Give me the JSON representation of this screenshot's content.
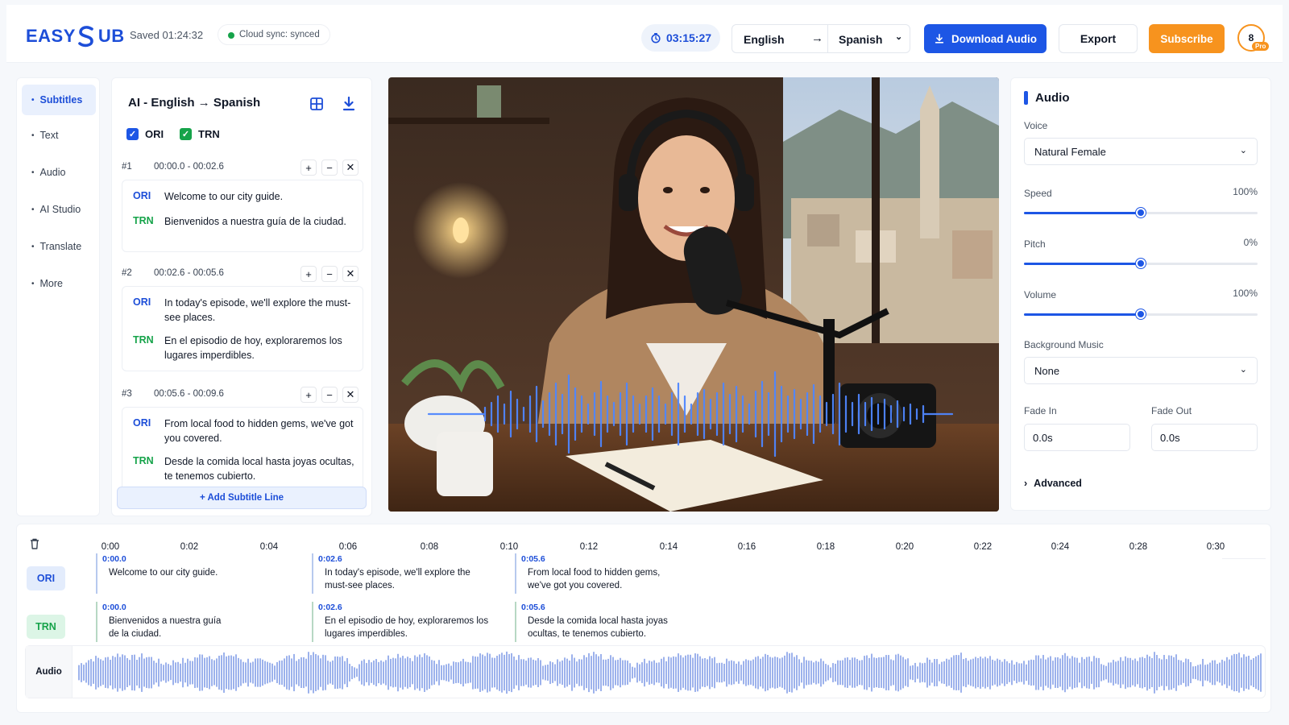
{
  "header": {
    "logo_text": "EASY",
    "logo_text_tail": "UB",
    "saved": "Saved 01:24:32",
    "sync": "Cloud sync: synced",
    "timer": "03:15:27",
    "source_lang": "English",
    "target_lang": "Spanish",
    "download_label": "Download Audio",
    "export_label": "Export",
    "subscribe_label": "Subscribe",
    "avatar_initial": "8",
    "avatar_badge": "Pro"
  },
  "nav": {
    "items": [
      {
        "label": "Subtitles",
        "active": true
      },
      {
        "label": "Text"
      },
      {
        "label": "Audio"
      },
      {
        "label": "AI Studio"
      },
      {
        "label": "Translate"
      },
      {
        "label": "More"
      }
    ]
  },
  "subtitles": {
    "title": "AI - English → Spanish",
    "ori_label": "ORI",
    "trn_label": "TRN",
    "lines": [
      {
        "num": "#1",
        "time": "00:00.0  -  00:02.6",
        "ori": "Welcome to our city guide.",
        "trn": "Bienvenidos a nuestra guía de la ciudad."
      },
      {
        "num": "#2",
        "time": "00:02.6  -  00:05.6",
        "ori": "In today's episode, we'll explore the must-see places.",
        "trn": "En el episodio de hoy, exploraremos los lugares imperdibles."
      },
      {
        "num": "#3",
        "time": "00:05.6  -  00:09.6",
        "ori": "From local food to hidden gems, we've got you covered.",
        "trn": "Desde la comida local hasta joyas ocultas, te tenemos cubierto."
      }
    ],
    "add_label": "+ Add Subtitle Line"
  },
  "audio_panel": {
    "title": "Audio",
    "voice_label": "Voice",
    "voice_value": "Natural Female",
    "speed_label": "Speed",
    "speed_value": "100%",
    "speed_level": 0.5,
    "pitch_label": "Pitch",
    "pitch_value": "0%",
    "pitch_level": 0.5,
    "volume_label": "Volume",
    "volume_value": "100%",
    "volume_level": 0.5,
    "bgm_label": "Background Music",
    "bgm_value": "None",
    "fade_in_label": "Fade In",
    "fade_in_value": "0.0s",
    "fade_out_label": "Fade Out",
    "fade_out_value": "0.0s",
    "advanced_label": "Advanced"
  },
  "timeline": {
    "ticks": [
      "0:00",
      "0:02",
      "0:04",
      "0:06",
      "0:08",
      "0:10",
      "0:12",
      "0:14",
      "0:16",
      "0:18",
      "0:20",
      "0:22",
      "0:24",
      "0:28",
      "0:30"
    ],
    "ori_label": "ORI",
    "trn_label": "TRN",
    "audio_label": "Audio",
    "ori_clips": [
      {
        "start": "0:00.0",
        "text": "Welcome to our city guide."
      },
      {
        "start": "0:02.6",
        "text": "In today's episode, we'll explore the must-see places."
      },
      {
        "start": "0:05.6",
        "text": "From local food to hidden gems, we've got you covered."
      }
    ],
    "trn_clips": [
      {
        "start": "0:00.0",
        "text": "Bienvenidos a nuestra guía de la ciudad."
      },
      {
        "start": "0:02.6",
        "text": "En el episodio de hoy, exploraremos los lugares imperdibles."
      },
      {
        "start": "0:05.6",
        "text": "Desde la comida local hasta joyas ocultas, te tenemos cubierto."
      }
    ]
  },
  "colors": {
    "accent": "#1d56e5",
    "ori": "#1d4ed8",
    "trn": "#16a34a",
    "subscribe": "#f7931e"
  }
}
